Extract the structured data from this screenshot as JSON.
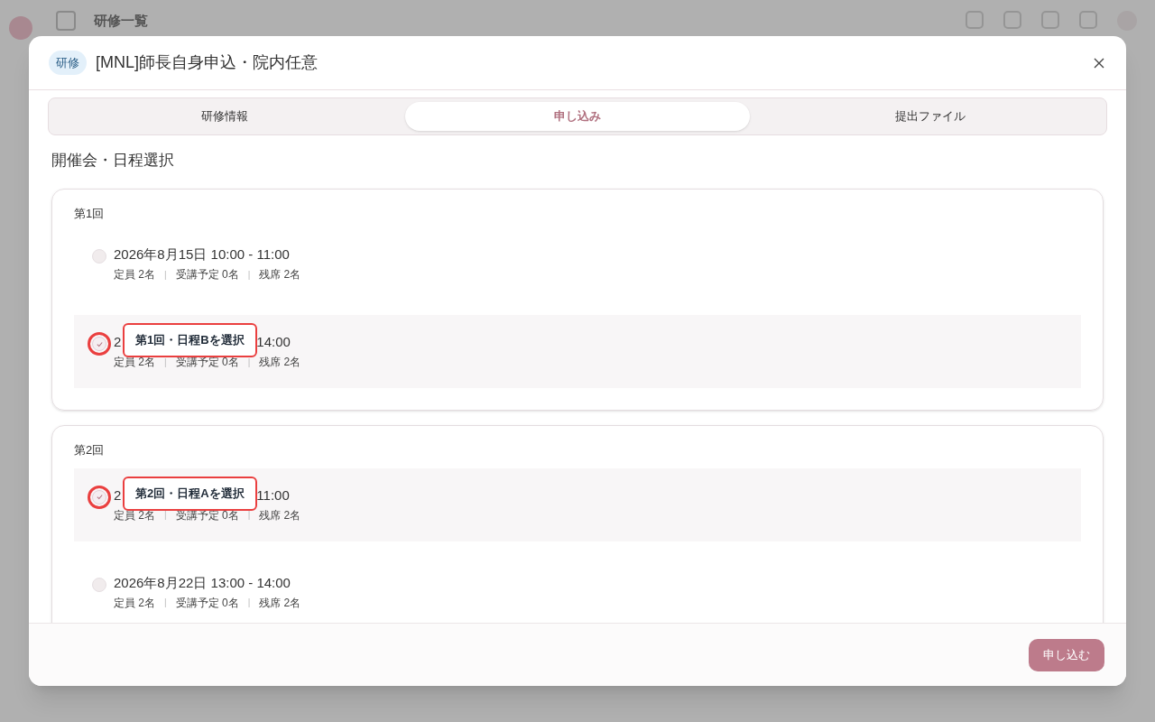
{
  "backdrop": {
    "page_title": "研修一覧"
  },
  "modal": {
    "badge": "研修",
    "title": "[MNL]師長自身申込・院内任意",
    "tabs": [
      {
        "label": "研修情報",
        "selected": false
      },
      {
        "label": "申し込み",
        "selected": true
      },
      {
        "label": "提出ファイル",
        "selected": false
      }
    ],
    "section_title": "開催会・日程選択",
    "meta_separator": "|",
    "sessions": [
      {
        "label": "第1回",
        "options": [
          {
            "selected": false,
            "date_parts": [
              "2026年8月15日 10:00 - 11:00"
            ],
            "meta": [
              "定員 2名",
              "受講予定 0名",
              "残席 2名"
            ]
          },
          {
            "selected": true,
            "date_parts": [
              "2",
              "14:00"
            ],
            "callout": "第1回・日程Bを選択",
            "meta": [
              "定員 2名",
              "受講予定 0名",
              "残席 2名"
            ]
          }
        ]
      },
      {
        "label": "第2回",
        "options": [
          {
            "selected": true,
            "date_parts": [
              "2",
              "11:00"
            ],
            "callout": "第2回・日程Aを選択",
            "meta": [
              "定員 2名",
              "受講予定 0名",
              "残席 2名"
            ]
          },
          {
            "selected": false,
            "date_parts": [
              "2026年8月22日 13:00 - 14:00"
            ],
            "meta": [
              "定員 2名",
              "受講予定 0名",
              "残席 2名"
            ]
          }
        ]
      }
    ],
    "submit": "申し込む"
  }
}
